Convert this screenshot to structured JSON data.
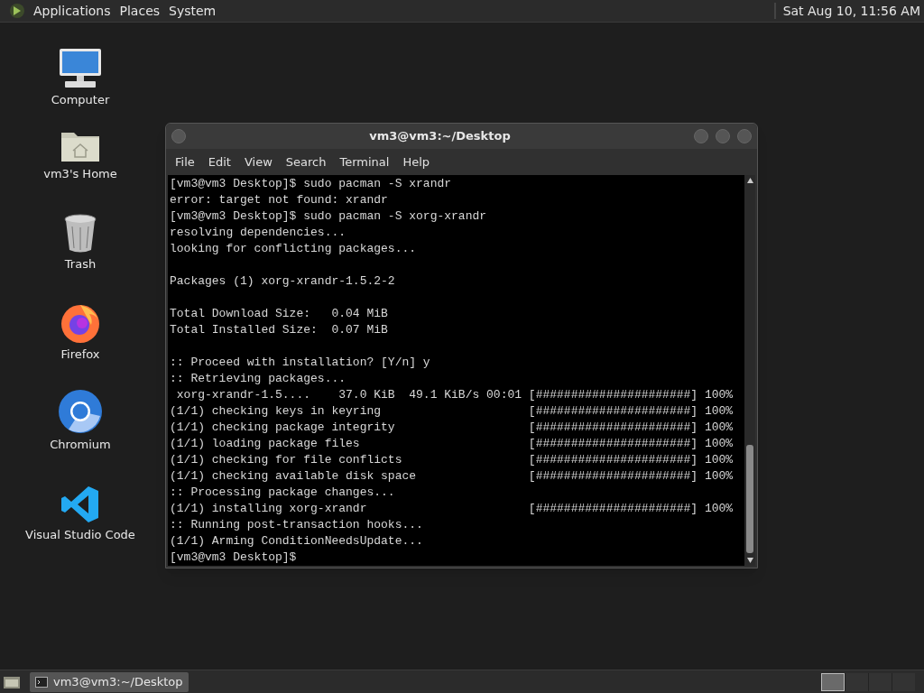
{
  "top_panel": {
    "menus": [
      "Applications",
      "Places",
      "System"
    ],
    "clock": "Sat Aug 10, 11:56 AM"
  },
  "desktop_icons": [
    {
      "kind": "computer",
      "label": "Computer"
    },
    {
      "kind": "home",
      "label": "vm3's Home"
    },
    {
      "kind": "trash",
      "label": "Trash"
    },
    {
      "kind": "firefox",
      "label": "Firefox"
    },
    {
      "kind": "chromium",
      "label": "Chromium"
    },
    {
      "kind": "vscode",
      "label": "Visual Studio Code"
    }
  ],
  "terminal": {
    "title": "vm3@vm3:~/Desktop",
    "menu": [
      "File",
      "Edit",
      "View",
      "Search",
      "Terminal",
      "Help"
    ],
    "blocks": [
      [
        {
          "kind": "text",
          "text": "[vm3@vm3 Desktop]$ sudo pacman -S xrandr"
        },
        {
          "kind": "text",
          "text": "error: target not found: xrandr"
        },
        {
          "kind": "text",
          "text": "[vm3@vm3 Desktop]$ sudo pacman -S xorg-xrandr"
        },
        {
          "kind": "text",
          "text": "resolving dependencies..."
        },
        {
          "kind": "text",
          "text": "looking for conflicting packages..."
        }
      ],
      [
        {
          "kind": "text",
          "text": "Packages (1) xorg-xrandr-1.5.2-2"
        }
      ],
      [
        {
          "kind": "text",
          "text": "Total Download Size:   0.04 MiB"
        },
        {
          "kind": "text",
          "text": "Total Installed Size:  0.07 MiB"
        }
      ],
      [
        {
          "kind": "text",
          "text": ":: Proceed with installation? [Y/n] y"
        },
        {
          "kind": "text",
          "text": ":: Retrieving packages..."
        },
        {
          "kind": "progress",
          "text": " xorg-xrandr-1.5....    37.0 KiB  49.1 KiB/s 00:01",
          "bar": "[######################]",
          "percent": "100%"
        },
        {
          "kind": "progress",
          "text": "(1/1) checking keys in keyring",
          "bar": "[######################]",
          "percent": "100%"
        },
        {
          "kind": "progress",
          "text": "(1/1) checking package integrity",
          "bar": "[######################]",
          "percent": "100%"
        },
        {
          "kind": "progress",
          "text": "(1/1) loading package files",
          "bar": "[######################]",
          "percent": "100%"
        },
        {
          "kind": "progress",
          "text": "(1/1) checking for file conflicts",
          "bar": "[######################]",
          "percent": "100%"
        },
        {
          "kind": "progress",
          "text": "(1/1) checking available disk space",
          "bar": "[######################]",
          "percent": "100%"
        },
        {
          "kind": "text",
          "text": ":: Processing package changes..."
        },
        {
          "kind": "progress",
          "text": "(1/1) installing xorg-xrandr",
          "bar": "[######################]",
          "percent": "100%"
        },
        {
          "kind": "text",
          "text": ":: Running post-transaction hooks..."
        },
        {
          "kind": "text",
          "text": "(1/1) Arming ConditionNeedsUpdate..."
        },
        {
          "kind": "text",
          "text": "[vm3@vm3 Desktop]$"
        }
      ]
    ]
  },
  "taskbar": {
    "tasks": [
      {
        "label": "vm3@vm3:~/Desktop",
        "selected": true
      }
    ],
    "workspaces": [
      {
        "selected": true
      },
      {
        "selected": false
      },
      {
        "selected": false
      },
      {
        "selected": false
      }
    ]
  }
}
